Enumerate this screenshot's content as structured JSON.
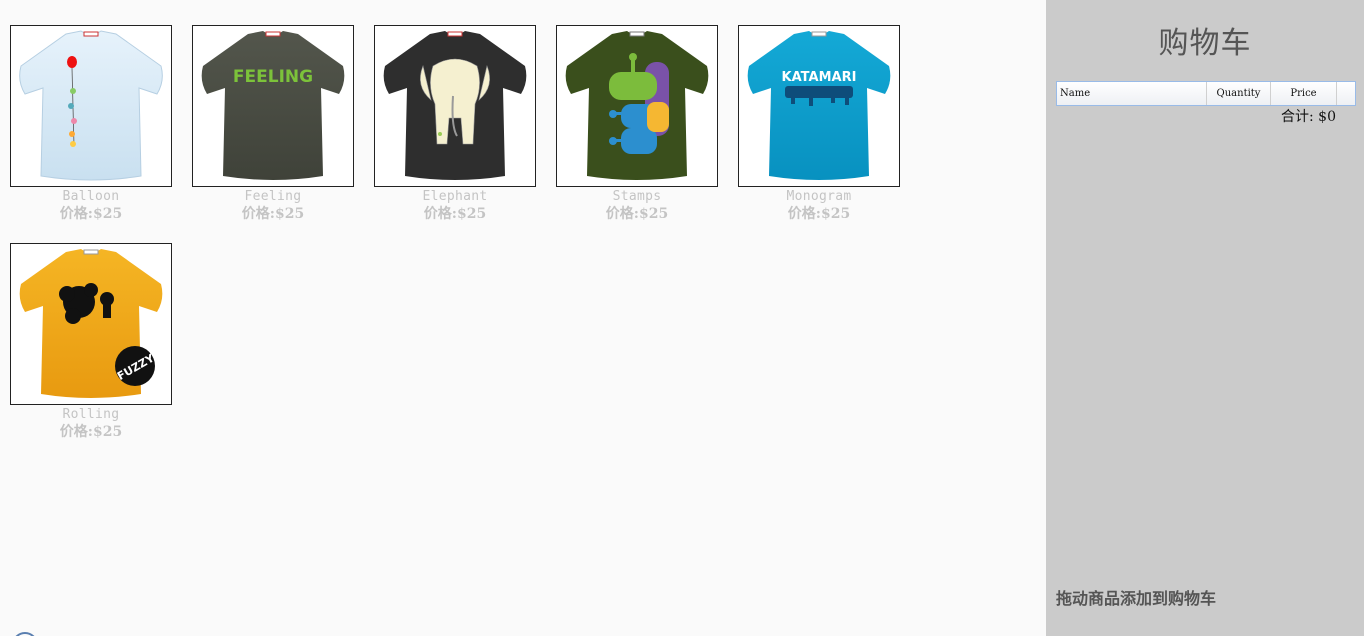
{
  "products": [
    {
      "name": "Balloon",
      "price": "价格:$25",
      "shirt_color": "#d9eaf7",
      "icon": "balloon-shirt-icon"
    },
    {
      "name": "Feeling",
      "price": "价格:$25",
      "shirt_color": "#4a4d44",
      "icon": "feeling-shirt-icon"
    },
    {
      "name": "Elephant",
      "price": "价格:$25",
      "shirt_color": "#333333",
      "icon": "elephant-shirt-icon"
    },
    {
      "name": "Stamps",
      "price": "价格:$25",
      "shirt_color": "#3a4f1c",
      "icon": "stamps-shirt-icon"
    },
    {
      "name": "Monogram",
      "price": "价格:$25",
      "shirt_color": "#0aa0cc",
      "icon": "monogram-shirt-icon"
    },
    {
      "name": "Rolling",
      "price": "价格:$25",
      "shirt_color": "#f2a922",
      "icon": "rolling-shirt-icon"
    }
  ],
  "cart": {
    "title": "购物车",
    "columns": [
      "Name",
      "Quantity",
      "Price"
    ],
    "total": "合计: $0",
    "hint": "拖动商品添加到购物车"
  },
  "shirt_graphics": {
    "feeling_text": "FEELING",
    "monogram_text": "KATAMARI",
    "rolling_badge": "FUZZY"
  },
  "colors": {
    "cart_bg": "#cbcbcb",
    "page_bg": "#fafafa",
    "label_gray": "#c4c4c4",
    "header_border": "#99bbe8"
  }
}
